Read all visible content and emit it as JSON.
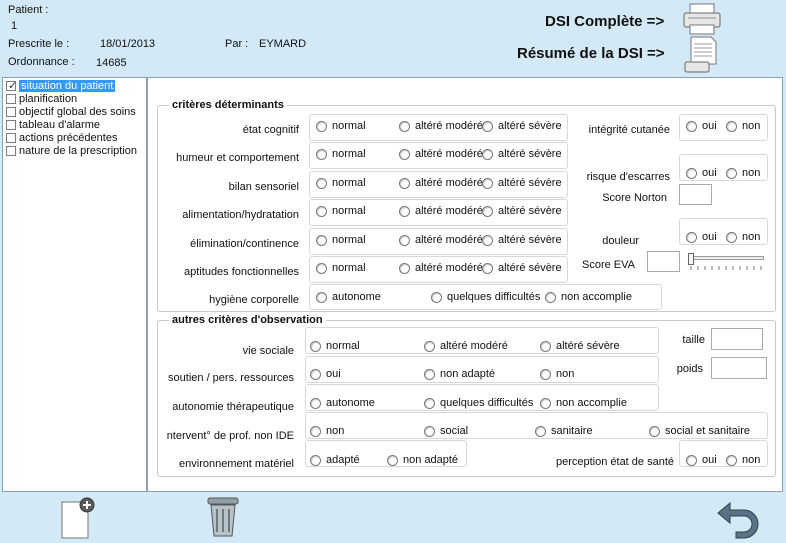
{
  "header": {
    "patient_label": "Patient :",
    "patient_value": "1",
    "prescrite_label": "Prescrite le :",
    "prescrite_value": "18/01/2013",
    "par_label": "Par :",
    "par_value": "EYMARD",
    "ordonnance_label": "Ordonnance :",
    "ordonnance_value": "14685",
    "dsi_complete": "DSI Complète =>",
    "resume_dsi": "Résumé de la DSI =>"
  },
  "sidebar": {
    "items": [
      {
        "label": "situation du patient",
        "checked": true
      },
      {
        "label": "planification",
        "checked": false
      },
      {
        "label": "objectif global des soins",
        "checked": false
      },
      {
        "label": "tableau d'alarme",
        "checked": false
      },
      {
        "label": "actions précédentes",
        "checked": false
      },
      {
        "label": "nature de la prescription",
        "checked": false
      }
    ]
  },
  "criteres": {
    "legend": "critères déterminants",
    "rows": [
      {
        "label": "état cognitif",
        "opts": [
          "normal",
          "altéré modéré",
          "altéré sévère"
        ]
      },
      {
        "label": "humeur et comportement",
        "opts": [
          "normal",
          "altéré modéré",
          "altéré sévère"
        ]
      },
      {
        "label": "bilan sensoriel",
        "opts": [
          "normal",
          "altéré modéré",
          "altéré sévère"
        ]
      },
      {
        "label": "alimentation/hydratation",
        "opts": [
          "normal",
          "altéré modéré",
          "altéré sévère"
        ]
      },
      {
        "label": "élimination/continence",
        "opts": [
          "normal",
          "altéré modéré",
          "altéré sévère"
        ]
      },
      {
        "label": "aptitudes fonctionnelles",
        "opts": [
          "normal",
          "altéré modéré",
          "altéré sévère"
        ]
      },
      {
        "label": "hygiène corporelle",
        "opts": [
          "autonome",
          "quelques difficultés",
          "non accomplie"
        ]
      }
    ],
    "integrite": {
      "label": "intégrité cutanée",
      "opts": [
        "oui",
        "non"
      ]
    },
    "escarres": {
      "label": "risque d'escarres",
      "opts": [
        "oui",
        "non"
      ]
    },
    "norton_label": "Score Norton",
    "douleur": {
      "label": "douleur",
      "opts": [
        "oui",
        "non"
      ]
    },
    "eva_label": "Score EVA"
  },
  "autres": {
    "legend": "autres critères d'observation",
    "rows": [
      {
        "label": "vie sociale",
        "opts": [
          "normal",
          "altéré modéré",
          "altéré sévère"
        ]
      },
      {
        "label": "soutien / pers. ressources",
        "opts": [
          "oui",
          "non adapté",
          "non"
        ]
      },
      {
        "label": "autonomie thérapeutique",
        "opts": [
          "autonome",
          "quelques difficultés",
          "non accomplie"
        ]
      },
      {
        "label": "ntervent° de prof. non IDE",
        "opts": [
          "non",
          "social",
          "sanitaire",
          "social et sanitaire"
        ]
      },
      {
        "label": "environnement matériel",
        "opts": [
          "adapté",
          "non adapté"
        ]
      }
    ],
    "taille_label": "taille",
    "poids_label": "poids",
    "perception": {
      "label": "perception état de santé",
      "opts": [
        "oui",
        "non"
      ]
    }
  },
  "colors": {
    "background": "#d3e9f5",
    "selection": "#3399ff",
    "border": "#8aa1b0"
  },
  "icons": {
    "dsi_complete": "printer-icon",
    "resume": "document-printer-icon",
    "new": "new-document-icon",
    "delete": "trash-icon",
    "back": "undo-arrow-icon"
  }
}
